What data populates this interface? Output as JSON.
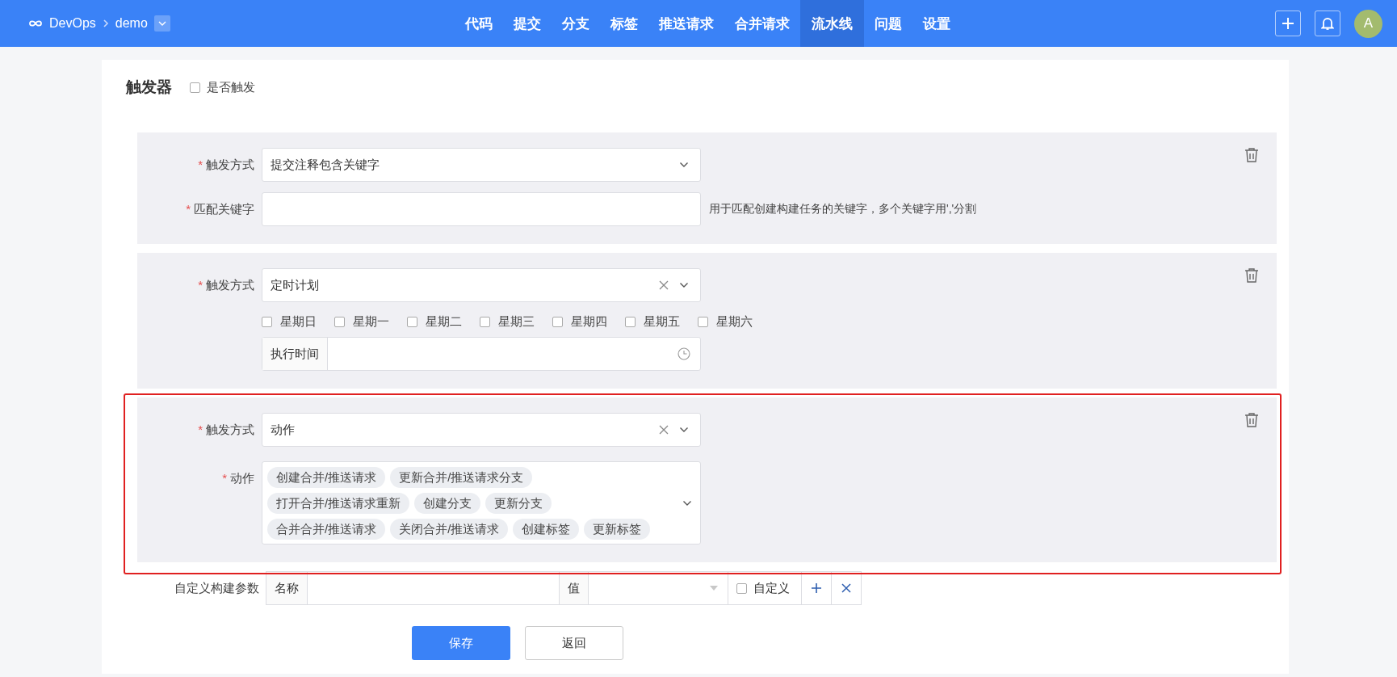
{
  "nav": {
    "brand": "DevOps",
    "project": "demo",
    "avatar": "A",
    "tabs": [
      {
        "label": "代码",
        "selected": false
      },
      {
        "label": "提交",
        "selected": false
      },
      {
        "label": "分支",
        "selected": false
      },
      {
        "label": "标签",
        "selected": false
      },
      {
        "label": "推送请求",
        "selected": false
      },
      {
        "label": "合并请求",
        "selected": false
      },
      {
        "label": "流水线",
        "selected": true
      },
      {
        "label": "问题",
        "selected": false
      },
      {
        "label": "设置",
        "selected": false
      }
    ]
  },
  "form": {
    "title": "触发器",
    "trigger_enabled": {
      "label": "是否触发",
      "checked": false
    },
    "triggers": [
      {
        "kind": "keyword",
        "highlighted": false,
        "method": {
          "required_mark": "*",
          "label": "触发方式",
          "value": "提交注释包含关键字",
          "clearable": false
        },
        "keyword": {
          "required_mark": "*",
          "label": "匹配关键字",
          "hint": "用于匹配创建构建任务的关键字，多个关键字用','分割"
        }
      },
      {
        "kind": "schedule",
        "highlighted": false,
        "method": {
          "required_mark": "*",
          "label": "触发方式",
          "value": "定时计划",
          "clearable": true
        },
        "days": [
          {
            "label": "星期日",
            "checked": false
          },
          {
            "label": "星期一",
            "checked": false
          },
          {
            "label": "星期二",
            "checked": false
          },
          {
            "label": "星期三",
            "checked": false
          },
          {
            "label": "星期四",
            "checked": false
          },
          {
            "label": "星期五",
            "checked": false
          },
          {
            "label": "星期六",
            "checked": false
          }
        ],
        "time_label": "执行时间"
      },
      {
        "kind": "action",
        "highlighted": true,
        "method": {
          "required_mark": "*",
          "label": "触发方式",
          "value": "动作",
          "clearable": true
        },
        "actions": {
          "required_mark": "*",
          "label": "动作",
          "tags": [
            "创建合并/推送请求",
            "更新合并/推送请求分支",
            "打开合并/推送请求重新",
            "创建分支",
            "更新分支",
            "合并合并/推送请求",
            "关闭合并/推送请求",
            "创建标签",
            "更新标签"
          ]
        }
      }
    ],
    "params": {
      "label": "自定义构建参数",
      "name_label": "名称",
      "value_label": "值",
      "custom": {
        "label": "自定义",
        "checked": false
      }
    },
    "buttons": {
      "save": "保存",
      "back": "返回"
    }
  }
}
